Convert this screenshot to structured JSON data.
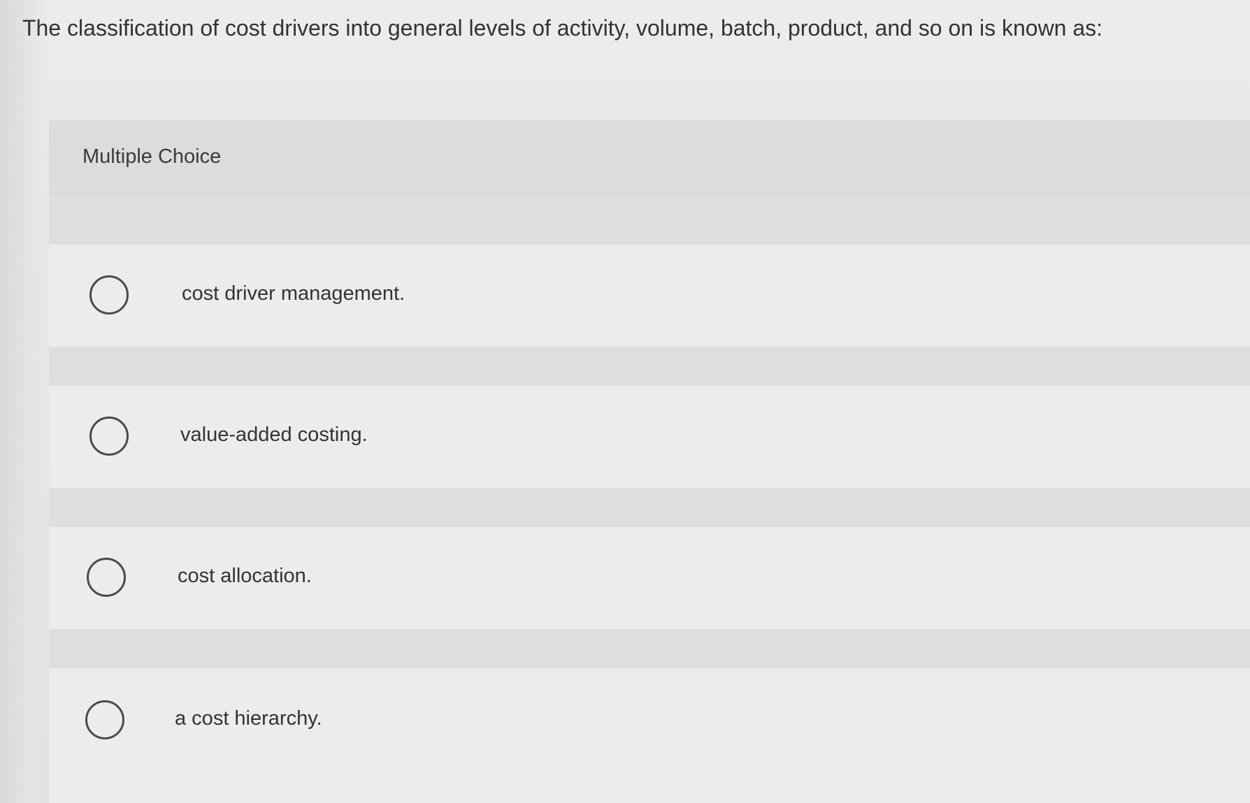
{
  "question": {
    "text": "The classification of cost drivers into general levels of activity, volume, batch, product, and so on is known as:"
  },
  "section": {
    "label": "Multiple Choice"
  },
  "choices": [
    {
      "label": "cost driver management."
    },
    {
      "label": "value-added costing."
    },
    {
      "label": "cost allocation."
    },
    {
      "label": "a cost hierarchy."
    }
  ]
}
